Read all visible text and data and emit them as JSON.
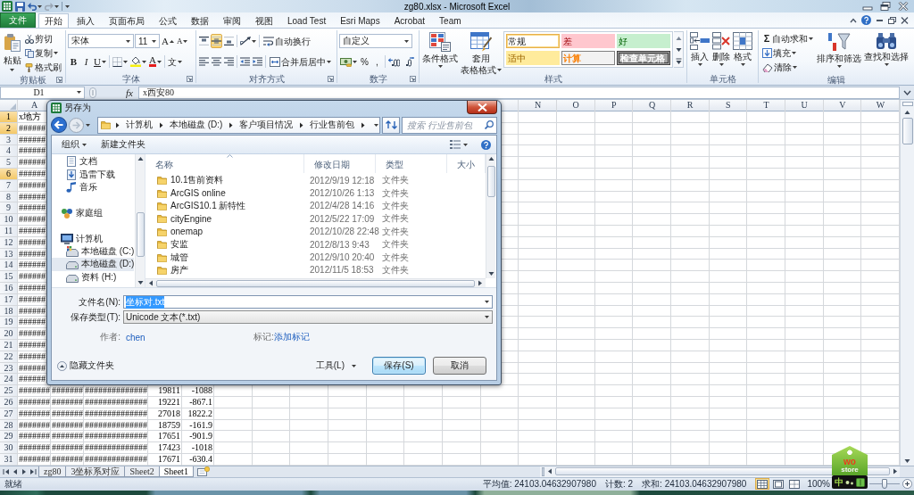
{
  "window": {
    "title": "zg80.xlsx - Microsoft Excel"
  },
  "ribbon_tabs": [
    {
      "label": "文件",
      "kind": "file",
      "selected": false
    },
    {
      "label": "开始",
      "kind": "tab",
      "selected": true
    },
    {
      "label": "插入",
      "kind": "tab",
      "selected": false
    },
    {
      "label": "页面布局",
      "kind": "tab",
      "selected": false
    },
    {
      "label": "公式",
      "kind": "tab",
      "selected": false
    },
    {
      "label": "数据",
      "kind": "tab",
      "selected": false
    },
    {
      "label": "审阅",
      "kind": "tab",
      "selected": false
    },
    {
      "label": "视图",
      "kind": "tab",
      "selected": false
    },
    {
      "label": "Load Test",
      "kind": "tab",
      "selected": false
    },
    {
      "label": "Esri Maps",
      "kind": "tab",
      "selected": false
    },
    {
      "label": "Acrobat",
      "kind": "tab",
      "selected": false
    },
    {
      "label": "Team",
      "kind": "tab",
      "selected": false
    }
  ],
  "ribbon": {
    "clipboard": {
      "label": "剪贴板",
      "paste": "粘贴",
      "cut": "剪切",
      "copy": "复制",
      "format_painter": "格式刷"
    },
    "font": {
      "label": "字体",
      "font_name": "宋体",
      "font_size": "11",
      "grow": "A",
      "shrink": "A",
      "bold": "B",
      "italic": "I",
      "underline": "U",
      "font_color": "A",
      "phonetic": "文"
    },
    "alignment": {
      "label": "对齐方式",
      "vertical_align": [
        {
          "selected": false
        },
        {
          "selected": true
        },
        {
          "selected": false
        }
      ],
      "wrap_text": "自动换行",
      "merge_center": "合并后居中"
    },
    "number": {
      "label": "数字",
      "format": "自定义",
      "percent": "%",
      "comma": ","
    },
    "styles": {
      "label": "样式",
      "conditional_formatting": "条件格式",
      "format_as_table": [
        "套用",
        "表格格式"
      ],
      "cell_styles": [
        {
          "label": "常规",
          "kind": "normal",
          "color": "#ffffff",
          "selected": true
        },
        {
          "label": "差",
          "kind": "bad",
          "color": "#ffc7ce",
          "selected": false
        },
        {
          "label": "好",
          "kind": "good",
          "color": "#c6efce",
          "selected": false
        },
        {
          "label": "适中",
          "kind": "neutral",
          "color": "#ffeb9c",
          "selected": false
        },
        {
          "label": "计算",
          "kind": "calculation",
          "color": "#f2f2f2",
          "selected": false
        },
        {
          "label": "检查单元格",
          "kind": "check",
          "color": "#a5a5a5",
          "selected": false
        }
      ]
    },
    "cells": {
      "label": "单元格",
      "insert": "插入",
      "delete": "删除",
      "format": "格式"
    },
    "editing": {
      "label": "编辑",
      "autosum_icon": "Σ",
      "autosum": "自动求和",
      "fill": "填充",
      "clear": "清除",
      "sort_filter": "排序和筛选",
      "find_select": "查找和选择"
    }
  },
  "formula_bar": {
    "name_box": "D1",
    "function_button": "fx",
    "value": "x西安80"
  },
  "sheet": {
    "columns_left": [
      "A"
    ],
    "columns_right": [
      "N",
      "O",
      "P",
      "Q",
      "R",
      "S",
      "T",
      "U",
      "V",
      "W"
    ],
    "rows": [
      {
        "number": "1",
        "selected": true,
        "cells": [
          "x地方"
        ]
      },
      {
        "number": "2",
        "selected": true,
        "cells": [
          "######"
        ]
      },
      {
        "number": "3",
        "selected": false,
        "cells": [
          "######"
        ]
      },
      {
        "number": "4",
        "selected": false,
        "cells": [
          "######"
        ]
      },
      {
        "number": "5",
        "selected": false,
        "cells": [
          "######"
        ]
      },
      {
        "number": "6",
        "selected": true,
        "cells": [
          "######"
        ]
      },
      {
        "number": "7",
        "selected": false,
        "cells": [
          "######"
        ]
      },
      {
        "number": "8",
        "selected": false,
        "cells": [
          "######"
        ]
      },
      {
        "number": "9",
        "selected": false,
        "cells": [
          "######"
        ]
      },
      {
        "number": "10",
        "selected": false,
        "cells": [
          "######"
        ]
      },
      {
        "number": "11",
        "selected": false,
        "cells": [
          "######"
        ]
      },
      {
        "number": "12",
        "selected": false,
        "cells": [
          "######"
        ]
      },
      {
        "number": "13",
        "selected": false,
        "cells": [
          "######"
        ]
      },
      {
        "number": "14",
        "selected": false,
        "cells": [
          "######"
        ]
      },
      {
        "number": "15",
        "selected": false,
        "cells": [
          "######"
        ]
      },
      {
        "number": "16",
        "selected": false,
        "cells": [
          "######"
        ]
      },
      {
        "number": "17",
        "selected": false,
        "cells": [
          "######"
        ]
      },
      {
        "number": "18",
        "selected": false,
        "cells": [
          "######"
        ]
      },
      {
        "number": "19",
        "selected": false,
        "cells": [
          "######"
        ]
      },
      {
        "number": "20",
        "selected": false,
        "cells": [
          "######"
        ]
      },
      {
        "number": "21",
        "selected": false,
        "cells": [
          "######"
        ]
      },
      {
        "number": "22",
        "selected": false,
        "cells": [
          "######"
        ]
      },
      {
        "number": "23",
        "selected": false,
        "cells": [
          "######"
        ]
      },
      {
        "number": "24",
        "selected": false,
        "cells": [
          "######"
        ]
      },
      {
        "number": "25",
        "selected": false,
        "cells": [
          "#######",
          "#######",
          "##############",
          "19811",
          "-1088"
        ]
      },
      {
        "number": "26",
        "selected": false,
        "cells": [
          "#######",
          "#######",
          "##############",
          "19221",
          "-867.1"
        ]
      },
      {
        "number": "27",
        "selected": false,
        "cells": [
          "#######",
          "#######",
          "##############",
          "27018",
          "1822.2"
        ]
      },
      {
        "number": "28",
        "selected": false,
        "cells": [
          "#######",
          "#######",
          "##############",
          "18759",
          "-161.9"
        ]
      },
      {
        "number": "29",
        "selected": false,
        "cells": [
          "#######",
          "#######",
          "##############",
          "17651",
          "-901.9"
        ]
      },
      {
        "number": "30",
        "selected": false,
        "cells": [
          "#######",
          "#######",
          "##############",
          "17423",
          "-1018"
        ]
      },
      {
        "number": "31",
        "selected": false,
        "cells": [
          "#######",
          "#######",
          "##############",
          "17671",
          "-630.4"
        ]
      }
    ]
  },
  "sheet_tabs": [
    {
      "label": "zg80",
      "selected": false
    },
    {
      "label": "3坐标系对应",
      "selected": false
    },
    {
      "label": "Sheet2",
      "selected": false
    },
    {
      "label": "Sheet1",
      "selected": true
    }
  ],
  "status_bar": {
    "status": "就绪",
    "average": "平均值: 24103.04632907980",
    "count": "计数: 2",
    "sum": "求和: 24103.04632907980",
    "views": [
      {
        "selected": true
      },
      {
        "selected": false
      },
      {
        "selected": false
      }
    ],
    "zoom": "100%",
    "zoom_slider": {
      "level": 0.5
    }
  },
  "save_dialog": {
    "title": "另存为",
    "path": [
      "计算机",
      "本地磁盘 (D:)",
      "客户项目情况",
      "行业售前包"
    ],
    "search_placeholder": "搜索 行业售前包",
    "toolbar": {
      "organize": "组织",
      "new_folder": "新建文件夹"
    },
    "nav": [
      {
        "children": [
          {
            "label": "文档",
            "kind": "documents",
            "selected": false
          },
          {
            "label": "迅雷下载",
            "kind": "downloads",
            "selected": false
          },
          {
            "label": "音乐",
            "kind": "music",
            "selected": false
          }
        ]
      },
      {
        "label": "家庭组",
        "kind": "homegroup",
        "selected": false
      },
      {
        "label": "计算机",
        "kind": "computer",
        "selected": false,
        "children": [
          {
            "label": "本地磁盘 (C:)",
            "kind": "system_drive",
            "selected": false
          },
          {
            "label": "本地磁盘 (D:)",
            "kind": "drive",
            "selected": true
          },
          {
            "label": "资料 (H:)",
            "kind": "drive",
            "selected": false
          }
        ]
      }
    ],
    "columns": [
      {
        "label": "名称",
        "sorted": true
      },
      {
        "label": "修改日期",
        "sorted": false
      },
      {
        "label": "类型",
        "sorted": false
      },
      {
        "label": "大小",
        "sorted": false
      }
    ],
    "files": [
      {
        "name": "10.1售前资料",
        "modified": "2012/9/19 12:18",
        "type": "文件夹"
      },
      {
        "name": "ArcGIS online",
        "modified": "2012/10/26 1:13",
        "type": "文件夹"
      },
      {
        "name": "ArcGIS10.1 新特性",
        "modified": "2012/4/28 14:16",
        "type": "文件夹"
      },
      {
        "name": "cityEngine",
        "modified": "2012/5/22 17:09",
        "type": "文件夹"
      },
      {
        "name": "onemap",
        "modified": "2012/10/28 22:48",
        "type": "文件夹"
      },
      {
        "name": "安监",
        "modified": "2012/8/13 9:43",
        "type": "文件夹"
      },
      {
        "name": "城管",
        "modified": "2012/9/10 20:40",
        "type": "文件夹"
      },
      {
        "name": "房产",
        "modified": "2012/11/5 18:53",
        "type": "文件夹"
      }
    ],
    "file_name": {
      "label": "文件名(N):",
      "value": "坐标对.txt",
      "selected": true
    },
    "save_type": {
      "label": "保存类型(T):",
      "value": "Unicode 文本(*.txt)"
    },
    "author": {
      "label": "作者:",
      "value": "chen"
    },
    "tags": {
      "label": "标记:",
      "value": "添加标记"
    },
    "hide_folders": "隐藏文件夹",
    "tools": "工具(L)",
    "buttons": [
      {
        "label": "保存(S)",
        "kind": "default"
      },
      {
        "label": "取消",
        "kind": "normal"
      }
    ]
  },
  "widget": {
    "logo": "wo",
    "logo_sub": "store",
    "ime_mode": "中"
  }
}
